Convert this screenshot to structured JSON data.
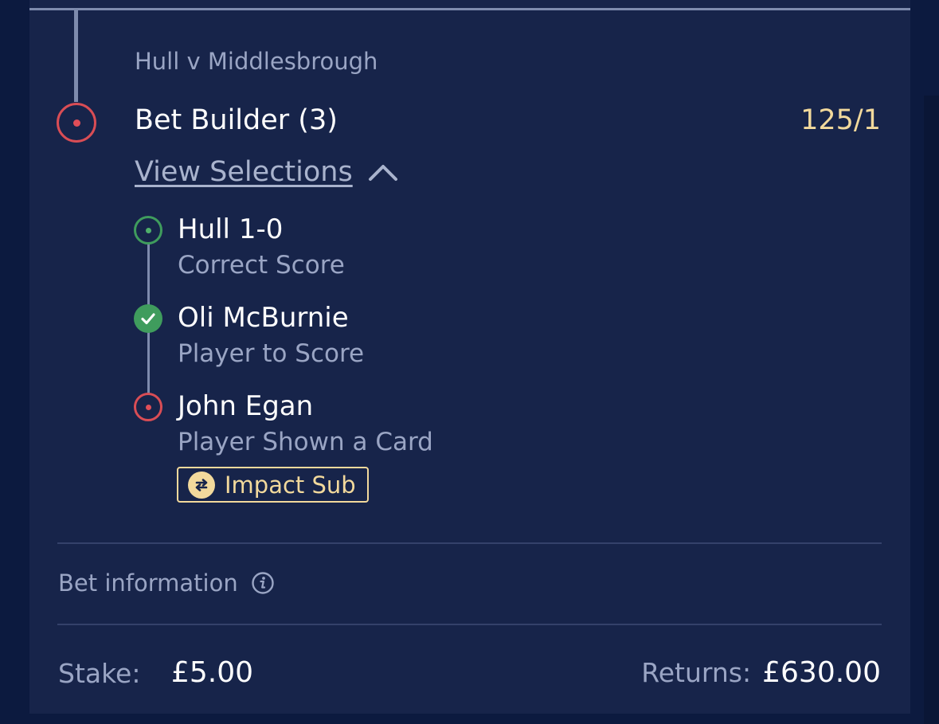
{
  "bet": {
    "match": "Hull v Middlesbrough",
    "title": "Bet Builder (3)",
    "odds": "125/1",
    "status_icon": "lost-ring-icon",
    "view_selections_label": "View Selections"
  },
  "selections": [
    {
      "name": "Hull 1-0",
      "market": "Correct Score",
      "status": "pending",
      "icon": "pending-ring-icon"
    },
    {
      "name": "Oli McBurnie",
      "market": "Player to Score",
      "status": "won",
      "icon": "check-icon"
    },
    {
      "name": "John Egan",
      "market": "Player Shown a Card",
      "status": "lost",
      "icon": "lost-ring-icon"
    }
  ],
  "impact_sub": {
    "label": "Impact Sub",
    "icon": "swap-arrows-icon"
  },
  "bet_information": {
    "label": "Bet information",
    "icon": "info-icon"
  },
  "stake": {
    "label": "Stake:",
    "value": "£5.00"
  },
  "returns": {
    "label": "Returns:",
    "value": "£630.00"
  },
  "colors": {
    "background": "#0c1a3f",
    "card": "#17244a",
    "odds_gold": "#f2d99c",
    "won_green": "#3f9c5d",
    "lost_red": "#d94d55",
    "muted_text": "#9aa5c4"
  }
}
